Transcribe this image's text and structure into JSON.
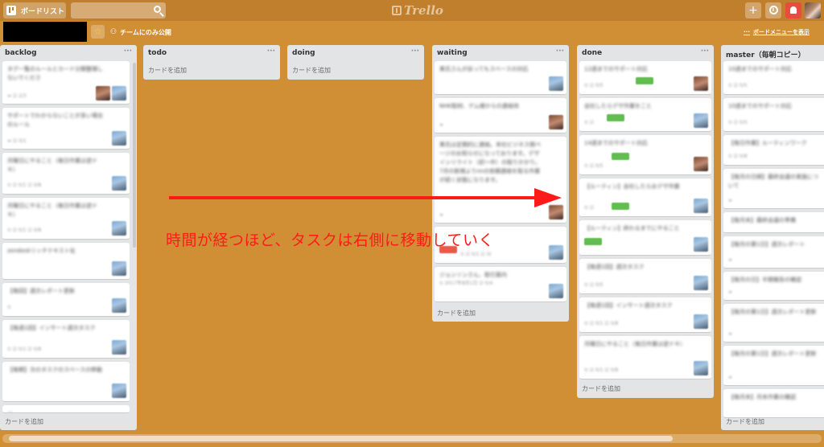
{
  "header": {
    "boards_label": "ボードリスト",
    "search_placeholder": "",
    "logo": "Trello"
  },
  "board": {
    "visibility_label": "チームにのみ公開",
    "show_menu_label": "ボードメニューを表示"
  },
  "add_card_label": "カードを追加",
  "lists": [
    {
      "title": "backlog"
    },
    {
      "title": "todo"
    },
    {
      "title": "doing"
    },
    {
      "title": "waiting"
    },
    {
      "title": "done"
    },
    {
      "title": "master（毎朝コピー）"
    }
  ],
  "annotation": "時間が経つほど、タスクは右側に移動していく",
  "colors": {
    "board_background": "#d18f35",
    "annotation": "#ff1a1a",
    "label_green": "#61bd4f",
    "label_red": "#eb5a46"
  }
}
